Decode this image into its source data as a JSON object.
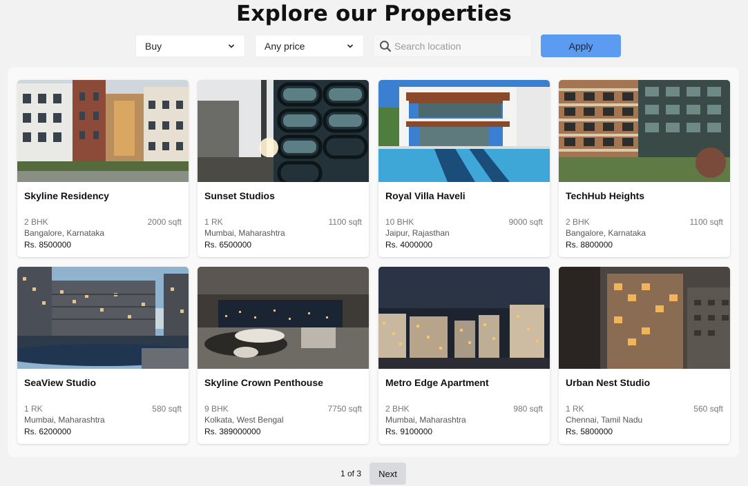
{
  "page": {
    "title": "Explore our Properties"
  },
  "filters": {
    "type_value": "Buy",
    "price_value": "Any price",
    "search_placeholder": "Search location",
    "apply_label": "Apply"
  },
  "icons": {
    "search": "search-icon",
    "chevron": "chevron-down-icon"
  },
  "colors": {
    "accent": "#5b9cf2",
    "background": "#f2f2f2",
    "card": "#ffffff",
    "next_button": "#d9dade"
  },
  "properties": [
    {
      "name": "Skyline Residency",
      "type": "2 BHK",
      "area": "2000 sqft",
      "location": "Bangalore, Karnataka",
      "price": "Rs. 8500000"
    },
    {
      "name": "Sunset Studios",
      "type": "1 RK",
      "area": "1100 sqft",
      "location": "Mumbai, Maharashtra",
      "price": "Rs. 6500000"
    },
    {
      "name": "Royal Villa Haveli",
      "type": "10 BHK",
      "area": "9000 sqft",
      "location": "Jaipur, Rajasthan",
      "price": "Rs. 4000000"
    },
    {
      "name": "TechHub Heights",
      "type": "2 BHK",
      "area": "1100 sqft",
      "location": "Bangalore, Karnataka",
      "price": "Rs. 8800000"
    },
    {
      "name": "SeaView Studio",
      "type": "1 RK",
      "area": "580 sqft",
      "location": "Mumbai, Maharashtra",
      "price": "Rs. 6200000"
    },
    {
      "name": "Skyline Crown Penthouse",
      "type": "9 BHK",
      "area": "7750 sqft",
      "location": "Kolkata, West Bengal",
      "price": "Rs. 389000000"
    },
    {
      "name": "Metro Edge Apartment",
      "type": "2 BHK",
      "area": "980 sqft",
      "location": "Mumbai, Maharashtra",
      "price": "Rs. 9100000"
    },
    {
      "name": "Urban Nest Studio",
      "type": "1 RK",
      "area": "560 sqft",
      "location": "Chennai, Tamil Nadu",
      "price": "Rs. 5800000"
    }
  ],
  "pagination": {
    "status": "1 of 3",
    "next_label": "Next"
  }
}
